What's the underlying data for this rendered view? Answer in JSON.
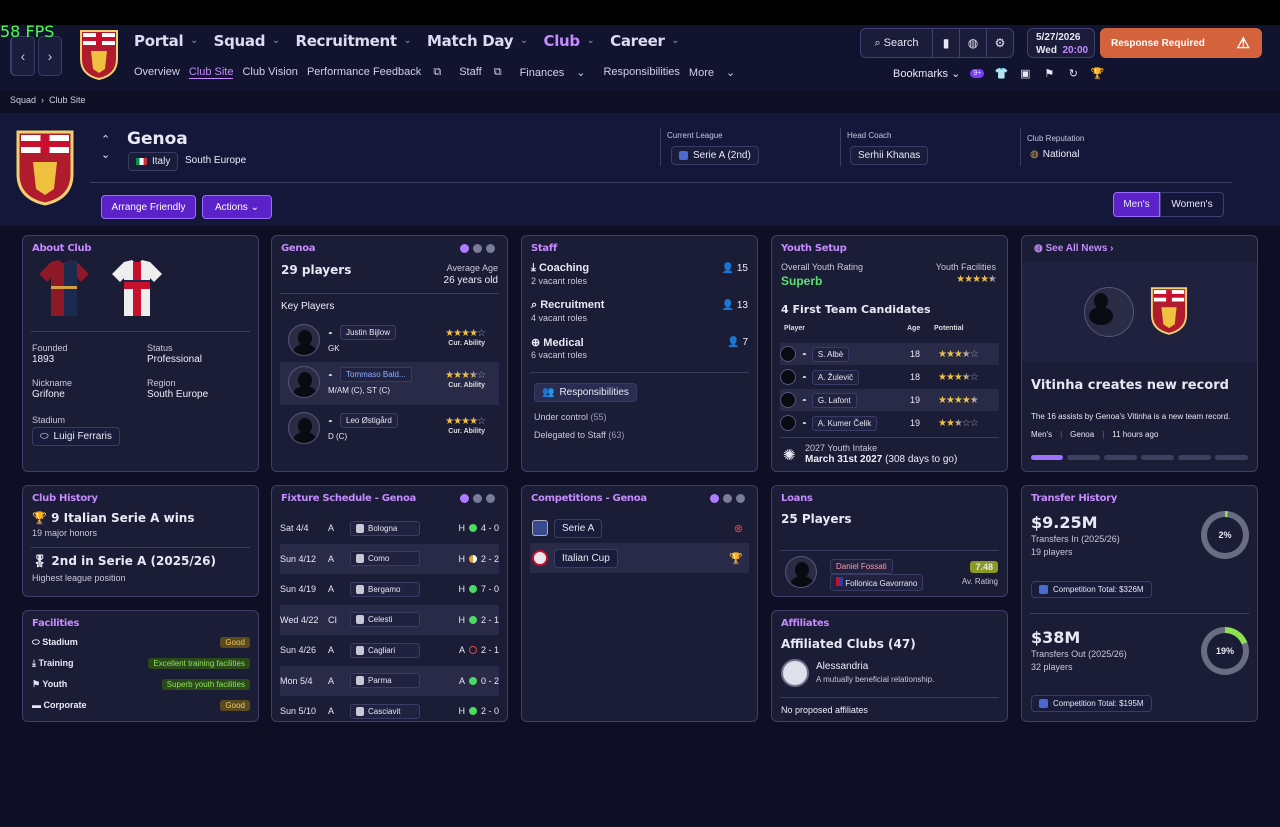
{
  "fps": "58 FPS",
  "nav": {
    "main": [
      "Portal",
      "Squad",
      "Recruitment",
      "Match Day",
      "Club",
      "Career"
    ],
    "sub": [
      "Overview",
      "Club Site",
      "Club Vision",
      "Performance Feedback",
      "Staff",
      "Finances",
      "Responsibilities",
      "More"
    ],
    "search": "Search",
    "date": "5/27/2026",
    "day": "Wed",
    "time": "20:00",
    "response": "Response Required",
    "bookmarks": "Bookmarks",
    "notif_count": "9+"
  },
  "breadcrumb": [
    "Squad",
    "Club Site"
  ],
  "club": {
    "name": "Genoa",
    "country": "Italy",
    "region_line": "South Europe",
    "league_label": "Current League",
    "league": "Serie A (2nd)",
    "coach_label": "Head Coach",
    "coach": "Serhii Khanas",
    "rep_label": "Club Reputation",
    "reputation": "National"
  },
  "buttons": {
    "friendly": "Arrange Friendly",
    "actions": "Actions",
    "men": "Men's",
    "women": "Women's"
  },
  "about": {
    "title": "About Club",
    "founded_l": "Founded",
    "founded": "1893",
    "status_l": "Status",
    "status": "Professional",
    "nick_l": "Nickname",
    "nick": "Grifone",
    "region_l": "Region",
    "region": "South Europe",
    "stadium_l": "Stadium",
    "stadium": "Luigi Ferraris"
  },
  "squad": {
    "title": "Genoa",
    "count": "29 players",
    "avg_l": "Average Age",
    "avg": "26 years old",
    "key": "Key Players",
    "cur": "Cur. Ability",
    "players": [
      {
        "name": "Justin Bijlow",
        "pos": "GK",
        "stars": 4
      },
      {
        "name": "Tommaso Bald...",
        "pos": "M/AM (C), ST (C)",
        "stars": 3.5
      },
      {
        "name": "Leo Østigård",
        "pos": "D (C)",
        "stars": 4
      }
    ]
  },
  "staff": {
    "title": "Staff",
    "groups": [
      {
        "name": "Coaching",
        "sub": "2 vacant roles",
        "n": "15"
      },
      {
        "name": "Recruitment",
        "sub": "4 vacant roles",
        "n": "13"
      },
      {
        "name": "Medical",
        "sub": "6 vacant roles",
        "n": "7"
      }
    ],
    "resp": "Responsibilities",
    "under": "Under control",
    "under_n": "(55)",
    "deleg": "Delegated to Staff",
    "deleg_n": "(63)"
  },
  "youth": {
    "title": "Youth Setup",
    "rating_l": "Overall Youth Rating",
    "rating": "Superb",
    "fac_l": "Youth Facilities",
    "fac_stars": 4.5,
    "cands": "4 First Team Candidates",
    "cols": [
      "Player",
      "Age",
      "Potential"
    ],
    "players": [
      {
        "name": "S. Albè",
        "age": "18",
        "stars": 3.5
      },
      {
        "name": "A. Žulevič",
        "age": "18",
        "stars": 3.5
      },
      {
        "name": "G. Lafont",
        "age": "19",
        "stars": 4.5
      },
      {
        "name": "A. Kumer Čelik",
        "age": "19",
        "stars": 2.5
      }
    ],
    "intake_l": "2027 Youth Intake",
    "intake": "March 31st 2027",
    "intake_d": "(308 days to go)"
  },
  "news": {
    "see": "See All News",
    "headline": "Vitinha creates new record",
    "body": "The 16 assists by Genoa's Vitinha is a new team record.",
    "tags": [
      "Men's",
      "Genoa",
      "11 hours ago"
    ]
  },
  "history": {
    "title": "Club History",
    "wins": "9 Italian Serie A wins",
    "honors": "19  major honors",
    "best": "2nd in Serie A (2025/26)",
    "best_sub": "Highest league position"
  },
  "facilities": {
    "title": "Facilities",
    "items": [
      {
        "name": "Stadium",
        "val": "Good"
      },
      {
        "name": "Training",
        "val": "Excellent training facilities"
      },
      {
        "name": "Youth",
        "val": "Superb youth facilities"
      },
      {
        "name": "Corporate",
        "val": "Good"
      }
    ]
  },
  "fixtures": {
    "title": "Fixture Schedule - Genoa",
    "rows": [
      {
        "d": "Sat 4/4",
        "c": "A",
        "t": "Bologna",
        "ha": "H",
        "r": "4 - 0",
        "res": "w"
      },
      {
        "d": "Sun 4/12",
        "c": "A",
        "t": "Como",
        "ha": "H",
        "r": "2 - 2",
        "res": "d"
      },
      {
        "d": "Sun 4/19",
        "c": "A",
        "t": "Bergamo",
        "ha": "H",
        "r": "7 - 0",
        "res": "w"
      },
      {
        "d": "Wed 4/22",
        "c": "CI",
        "t": "Celesti",
        "ha": "H",
        "r": "2 - 1",
        "res": "w"
      },
      {
        "d": "Sun 4/26",
        "c": "A",
        "t": "Cagliari",
        "ha": "A",
        "r": "2 - 1",
        "res": "l"
      },
      {
        "d": "Mon 5/4",
        "c": "A",
        "t": "Parma",
        "ha": "A",
        "r": "0 - 2",
        "res": "w"
      },
      {
        "d": "Sun 5/10",
        "c": "A",
        "t": "Casciavit",
        "ha": "H",
        "r": "2 - 0",
        "res": "w"
      }
    ]
  },
  "comps": {
    "title": "Competitions - Genoa",
    "items": [
      "Serie A",
      "Italian Cup"
    ]
  },
  "loans": {
    "title": "Loans",
    "count": "25 Players",
    "player": "Daniel Fossati",
    "club": "Follonica Gavorrano",
    "rating": "7.48",
    "rating_l": "Av. Rating"
  },
  "affiliates": {
    "title": "Affiliates",
    "count": "Affiliated Clubs (47)",
    "club": "Alessandria",
    "desc": "A mutually beneficial relationship.",
    "none": "No proposed affiliates"
  },
  "transfers": {
    "title": "Transfer History",
    "in": "$9.25M",
    "in_l": "Transfers In (2025/26)",
    "in_p": "19 players",
    "in_pct": "2%",
    "in_pct_v": 2,
    "in_comp": "Competition Total:  $326M",
    "out": "$38M",
    "out_l": "Transfers Out (2025/26)",
    "out_p": "32 players",
    "out_pct": "19%",
    "out_pct_v": 19,
    "out_comp": "Competition Total:  $195M"
  },
  "colors": {
    "accent": "#c58bff",
    "button": "#5a22c8",
    "response": "#d4623c",
    "star": "#f0c040",
    "win": "#4cd964",
    "loss": "#e04848"
  }
}
